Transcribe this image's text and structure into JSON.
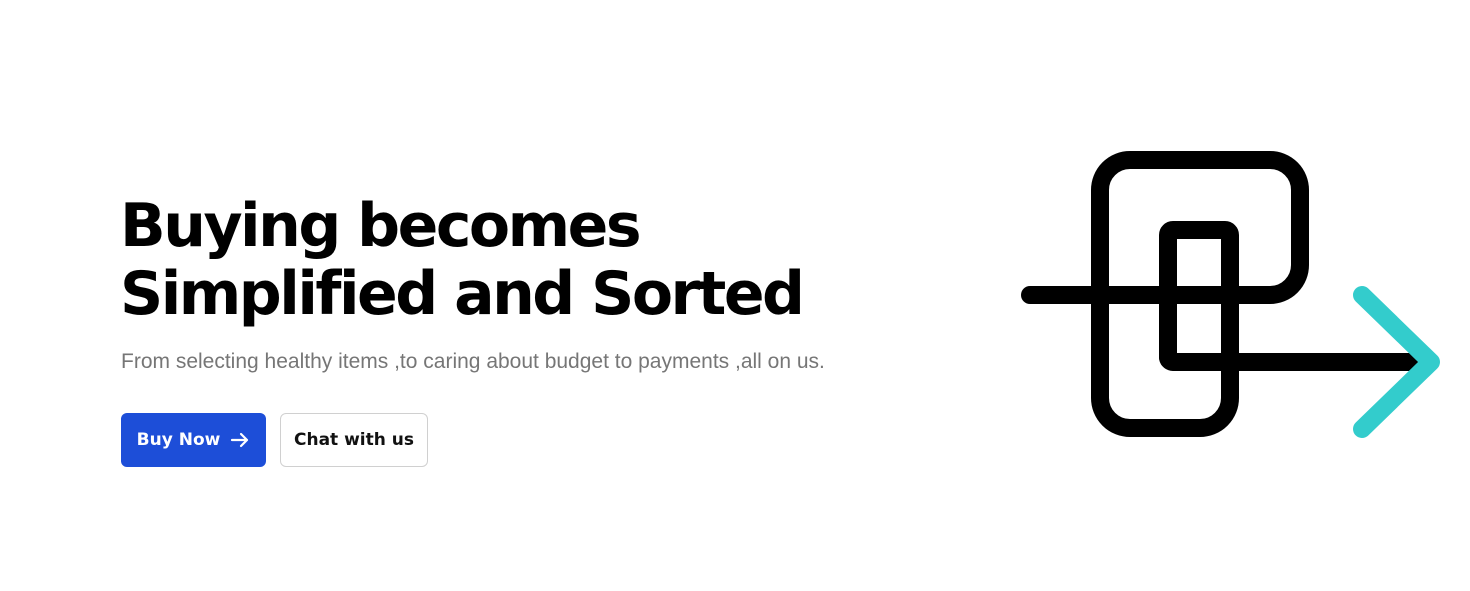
{
  "hero": {
    "headline_line1": "Buying becomes",
    "headline_line2": "Simplified and Sorted",
    "subtitle": "From selecting healthy items ,to caring about budget to payments ,all on us.",
    "primary_button": {
      "label": "Buy Now",
      "icon": "arrow-right-icon"
    },
    "secondary_button": {
      "label": "Chat with us"
    }
  },
  "logo": {
    "icon": "linked-squares-arrow-logo"
  },
  "colors": {
    "primary": "#1d4ed8",
    "accent": "#33cccc",
    "text": "#000000",
    "muted_text": "#767676",
    "border": "#d0d0d0"
  }
}
